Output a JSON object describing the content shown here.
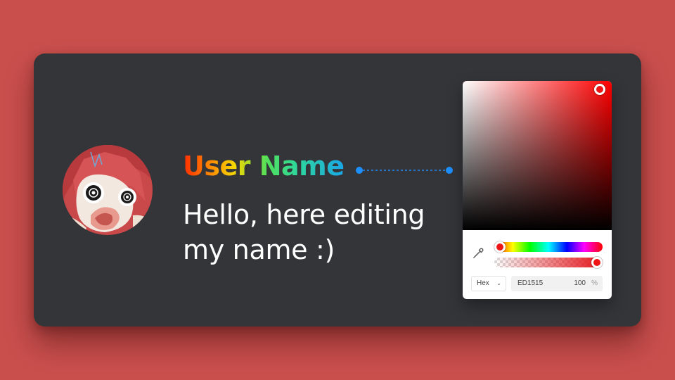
{
  "profile": {
    "user_name": "User Name",
    "message": "Hello, here editing my name :)"
  },
  "color_picker": {
    "format": "Hex",
    "hex_value": "ED1515",
    "alpha_value": "100",
    "alpha_unit": "%",
    "hue_color": "#ff0000",
    "selected_color": "#ED1515",
    "hue_position": 0.0,
    "alpha_position": 1.0
  },
  "colors": {
    "background": "#c94f4d",
    "card": "#333539",
    "connector": "#1e8fff",
    "message_text": "#ffffff"
  },
  "icons": {
    "eyedropper": "eyedropper-icon",
    "format_chevron": "chevron-down-icon"
  }
}
